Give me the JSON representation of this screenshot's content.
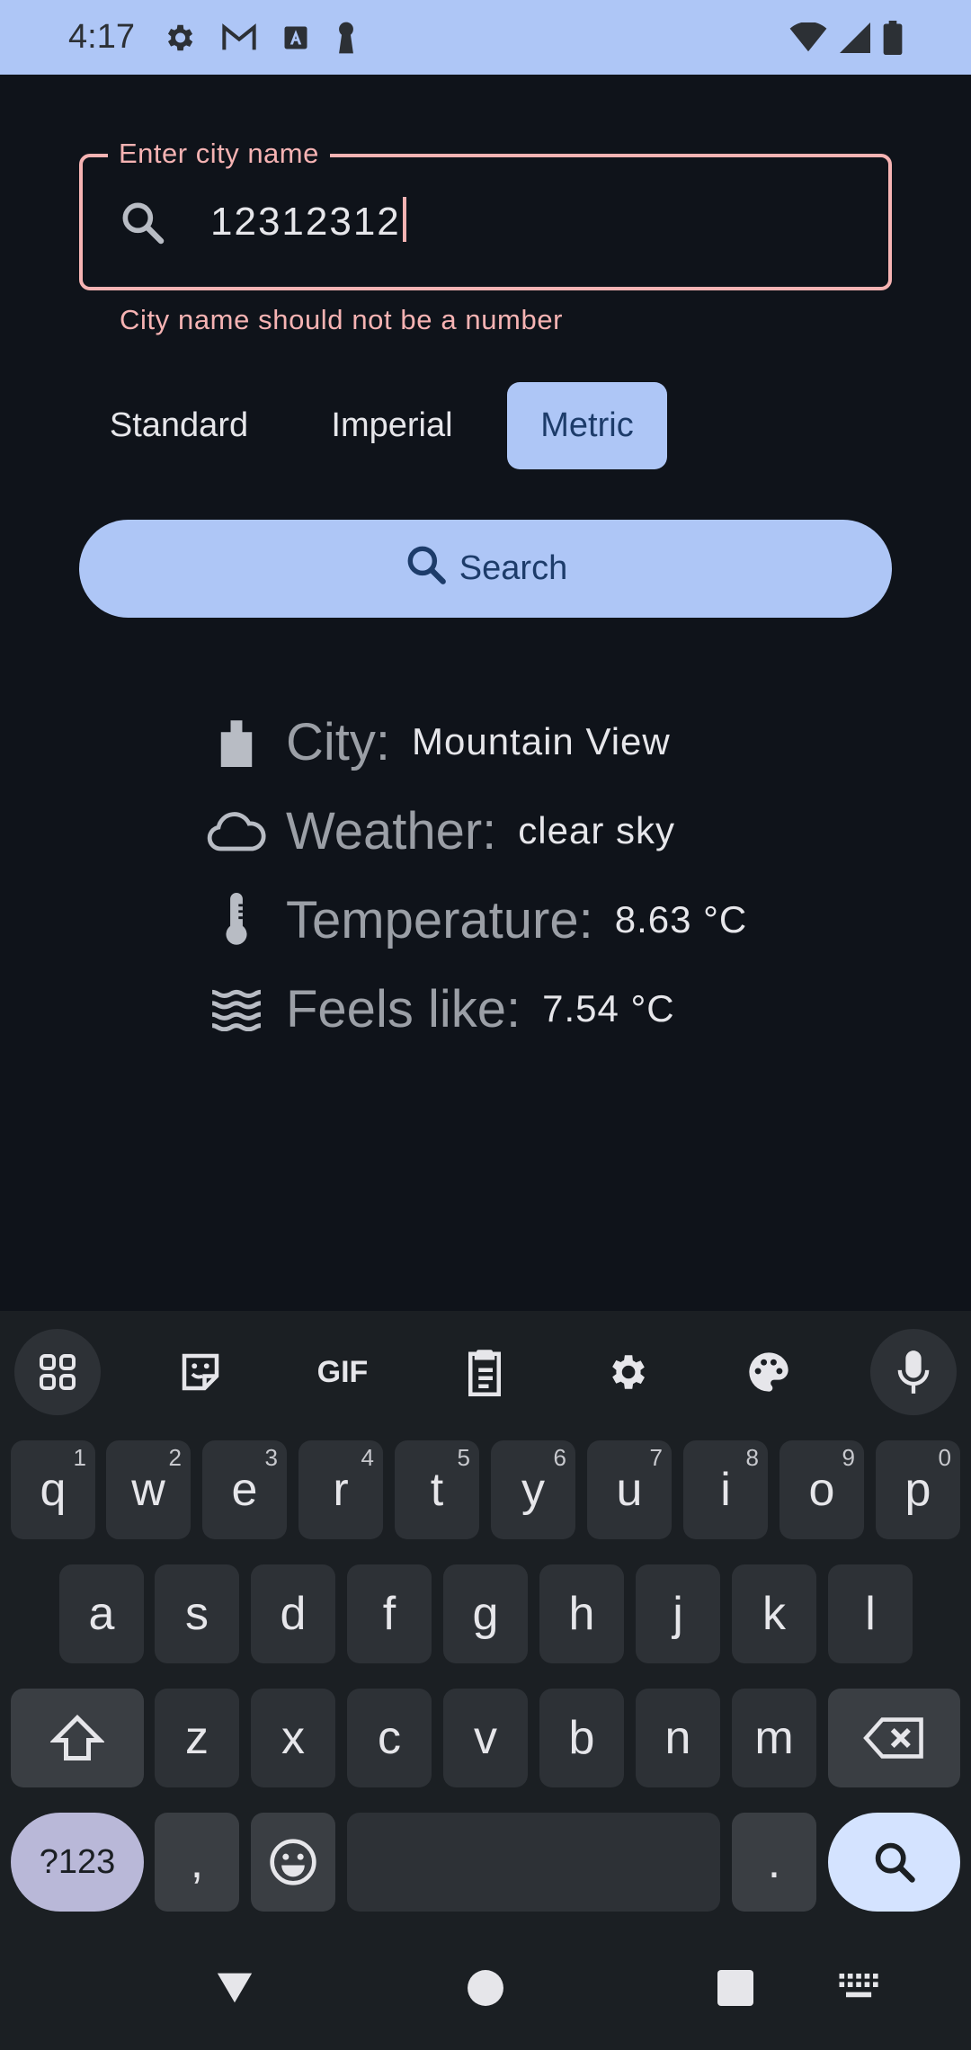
{
  "status_bar": {
    "time": "4:17",
    "left_icons": [
      "gear-icon",
      "gmail-icon",
      "font-icon",
      "keyhole-icon"
    ],
    "right_icons": [
      "wifi-icon",
      "signal-icon",
      "battery-icon"
    ]
  },
  "city_field": {
    "label": "Enter city name",
    "value": "12312312",
    "error": "City name should not be a number"
  },
  "units": {
    "options": [
      "Standard",
      "Imperial",
      "Metric"
    ],
    "selected": "Metric"
  },
  "search_button": {
    "label": "Search"
  },
  "weather": {
    "city_label": "City:",
    "city_value": "Mountain View",
    "weather_label": "Weather:",
    "weather_value": "clear sky",
    "temperature_label": "Temperature:",
    "temperature_value": "8.63 °C",
    "feels_like_label": "Feels like:",
    "feels_like_value": "7.54 °C"
  },
  "keyboard": {
    "row1": [
      {
        "key": "q",
        "hint": "1"
      },
      {
        "key": "w",
        "hint": "2"
      },
      {
        "key": "e",
        "hint": "3"
      },
      {
        "key": "r",
        "hint": "4"
      },
      {
        "key": "t",
        "hint": "5"
      },
      {
        "key": "y",
        "hint": "6"
      },
      {
        "key": "u",
        "hint": "7"
      },
      {
        "key": "i",
        "hint": "8"
      },
      {
        "key": "o",
        "hint": "9"
      },
      {
        "key": "p",
        "hint": "0"
      }
    ],
    "row2": [
      "a",
      "s",
      "d",
      "f",
      "g",
      "h",
      "j",
      "k",
      "l"
    ],
    "row3": [
      "z",
      "x",
      "c",
      "v",
      "b",
      "n",
      "m"
    ],
    "sym_label": "?123",
    "comma": ",",
    "period": ".",
    "toolbar": [
      "apps-grid-icon",
      "sticker-icon",
      "gif-icon",
      "clipboard-icon",
      "settings-icon",
      "palette-icon",
      "microphone-icon"
    ],
    "gif_label": "GIF"
  },
  "colors": {
    "accent": "#aec6f6",
    "error": "#f6b3b3",
    "background": "#0f131a",
    "keyboard_bg": "#1b1f23"
  }
}
